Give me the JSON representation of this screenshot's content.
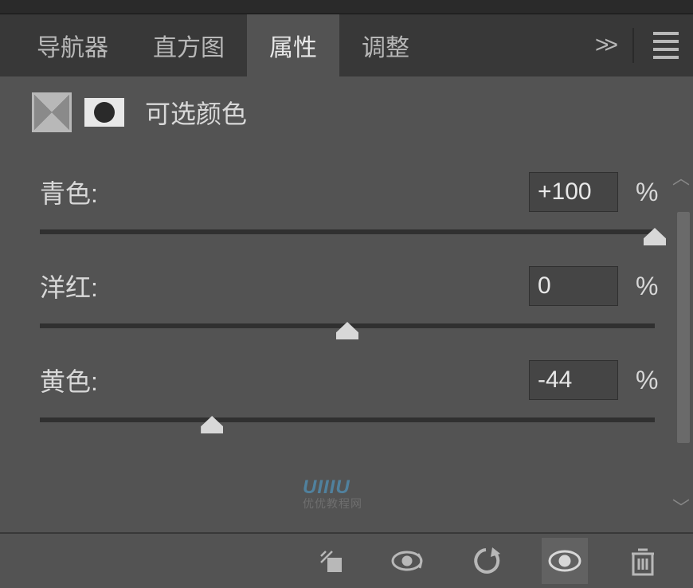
{
  "tabs": {
    "navigator": "导航器",
    "histogram": "直方图",
    "properties": "属性",
    "adjustments": "调整"
  },
  "panel": {
    "title": "可选颜色"
  },
  "sliders": [
    {
      "label": "青色:",
      "value": "+100",
      "unit": "%",
      "handle_pct": 100
    },
    {
      "label": "洋红:",
      "value": "0",
      "unit": "%",
      "handle_pct": 50
    },
    {
      "label": "黄色:",
      "value": "-44",
      "unit": "%",
      "handle_pct": 28
    }
  ],
  "watermark": {
    "line1": "UIIIU",
    "line2": "优优教程网"
  }
}
